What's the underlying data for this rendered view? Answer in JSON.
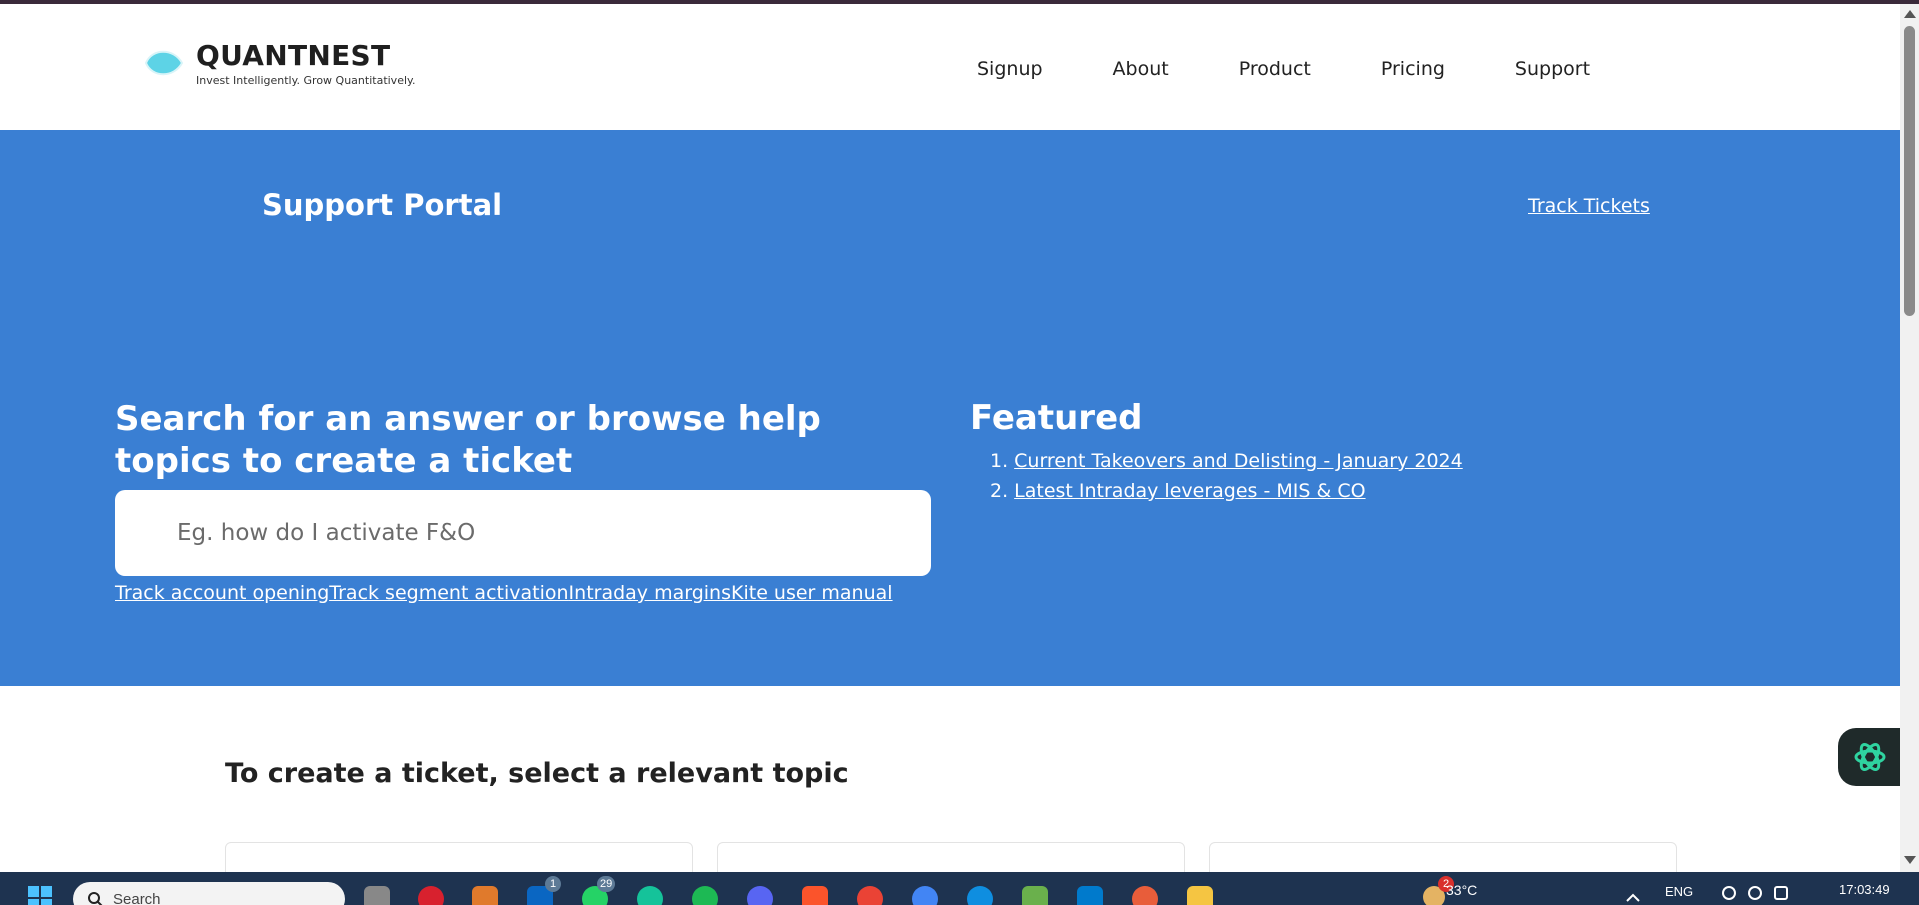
{
  "brand": {
    "name": "QUANTNEST",
    "tagline": "Invest Intelligently. Grow Quantitatively.",
    "accent_color": "#5dd3e6"
  },
  "nav": {
    "items": [
      {
        "label": "Signup"
      },
      {
        "label": "About"
      },
      {
        "label": "Product"
      },
      {
        "label": "Pricing"
      },
      {
        "label": "Support"
      }
    ]
  },
  "hero": {
    "background": "#3a7fd3",
    "title": "Support Portal",
    "track_tickets": "Track Tickets",
    "search_heading": "Search for an answer or browse help topics to create a ticket",
    "search_placeholder": "Eg. how do I activate F&O",
    "quick_links": [
      {
        "label": "Track account opening"
      },
      {
        "label": "Track segment activation"
      },
      {
        "label": "Intraday margins"
      },
      {
        "label": "Kite user manual"
      }
    ],
    "featured_title": "Featured",
    "featured": [
      {
        "num": "1.",
        "label": "Current Takeovers and Delisting - January 2024"
      },
      {
        "num": "2.",
        "label": "Latest Intraday leverages - MIS & CO"
      }
    ]
  },
  "topics": {
    "heading": "To create a ticket, select a relevant topic"
  },
  "taskbar": {
    "search_label": "Search",
    "linkedin_badge": "1",
    "whatsapp_badge": "29",
    "weather_badge": "2",
    "temperature": "33°C",
    "language": "ENG",
    "time": "17:03:49"
  }
}
